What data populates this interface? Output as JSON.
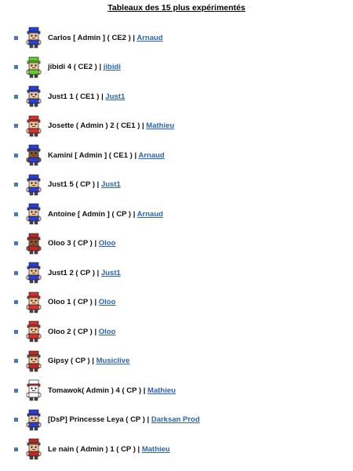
{
  "title": "Tableaux des 15 plus expérimentés",
  "rows": [
    {
      "name": "Carlos [ Admin ] ( CE2 ) |",
      "link": "Arnaud",
      "skin": "#f0c89c",
      "cap": "#2a3fd8",
      "shirt": "#2a3fd8",
      "hair": "#2a3fd8"
    },
    {
      "name": "jibidi 4 ( CE2 ) |",
      "link": "jibidi",
      "skin": "#f0c89c",
      "cap": "#5fd22a",
      "shirt": "#5fd22a",
      "hair": "#5fd22a"
    },
    {
      "name": "Just1 1 ( CE1 ) |",
      "link": "Just1",
      "skin": "#f0c89c",
      "cap": "#2a3fd8",
      "shirt": "#2a3fd8",
      "hair": "#2a3fd8"
    },
    {
      "name": "Josette ( Admin ) 2 ( CE1 ) |",
      "link": "Mathieu",
      "skin": "#f0c89c",
      "cap": "#d83030",
      "shirt": "#d83030",
      "hair": "#d83030"
    },
    {
      "name": "Kamini [ Admin ] ( CE1 ) |",
      "link": "Arnaud",
      "skin": "#8a5a32",
      "cap": "#2a3fd8",
      "shirt": "#2a3fd8",
      "hair": "#2a3fd8"
    },
    {
      "name": "Just1 5 ( CP ) |",
      "link": "Just1",
      "skin": "#f0c89c",
      "cap": "#2a3fd8",
      "shirt": "#2a3fd8",
      "hair": "#2a3fd8"
    },
    {
      "name": "Antoine [ Admin ] ( CP ) |",
      "link": "Arnaud",
      "skin": "#f0c89c",
      "cap": "#2a3fd8",
      "shirt": "#2a3fd8",
      "hair": "#2a3fd8"
    },
    {
      "name": "Oloo 3 ( CP ) |",
      "link": "Oloo",
      "skin": "#8a5a32",
      "cap": "#c02828",
      "shirt": "#c02828",
      "hair": "#c02828"
    },
    {
      "name": "Just1 2 ( CP ) |",
      "link": "Just1",
      "skin": "#f0c89c",
      "cap": "#2a3fd8",
      "shirt": "#2a3fd8",
      "hair": "#2a3fd8"
    },
    {
      "name": "Oloo 1 ( CP ) |",
      "link": "Oloo",
      "skin": "#f0c89c",
      "cap": "#d83030",
      "shirt": "#d83030",
      "hair": "#d83030"
    },
    {
      "name": "Oloo 2 ( CP ) |",
      "link": "Oloo",
      "skin": "#f0c89c",
      "cap": "#d83030",
      "shirt": "#d83030",
      "hair": "#d83030"
    },
    {
      "name": "Gipsy ( CP ) |",
      "link": "Musiclive",
      "skin": "#f0c89c",
      "cap": "#c02828",
      "shirt": "#c02828",
      "hair": "#8a5a32"
    },
    {
      "name": "Tomawok( Admin ) 4 ( CP ) |",
      "link": "Mathieu",
      "skin": "#ffffff",
      "cap": "#ffffff",
      "shirt": "#ffffff",
      "hair": "#d83030"
    },
    {
      "name": "[DsP] Princesse Leya ( CP ) |",
      "link": "Darksan Prod",
      "skin": "#f0c89c",
      "cap": "#2a3fd8",
      "shirt": "#2a3fd8",
      "hair": "#2a3fd8"
    },
    {
      "name": "Le nain ( Admin ) 1 ( CP ) |",
      "link": "Mathieu",
      "skin": "#f0c89c",
      "cap": "#c02828",
      "shirt": "#c02828",
      "hair": "#8a5a32"
    }
  ]
}
